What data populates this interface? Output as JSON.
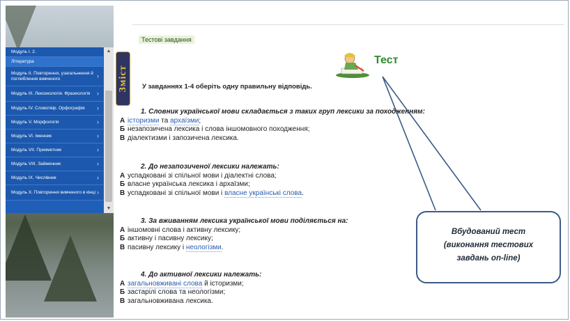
{
  "sidebar": {
    "items": [
      {
        "label": "Модуль І. 2.",
        "sub": false,
        "arrow": ""
      },
      {
        "label": "Література",
        "sub": true,
        "arrow": ""
      },
      {
        "label": "Модуль ІІ. Повторення, узагальнення й поглиблення вивченого",
        "sub": false,
        "arrow": "›"
      },
      {
        "label": "Модуль ІІІ. Лексикологія. Фразеологія",
        "sub": false,
        "arrow": "›"
      },
      {
        "label": "Модуль IV. Словотвір. Орфографія",
        "sub": false,
        "arrow": "›"
      },
      {
        "label": "Модуль V. Морфологія",
        "sub": false,
        "arrow": "›"
      },
      {
        "label": "Модуль VI. Іменник",
        "sub": false,
        "arrow": "›"
      },
      {
        "label": "Модуль VII. Прикметник",
        "sub": false,
        "arrow": "›"
      },
      {
        "label": "Модуль VIII. Займенник",
        "sub": false,
        "arrow": "›"
      },
      {
        "label": "Модуль IX. Числівник",
        "sub": false,
        "arrow": "›"
      },
      {
        "label": "Модуль X. Повторення вивченого в кінці",
        "sub": false,
        "arrow": "›"
      }
    ],
    "scroll_up": "▲",
    "scroll_down": "▼"
  },
  "contents_tab": "Зміст",
  "page": {
    "tab_label": "Тестові завдання",
    "test_title": "Тест",
    "instruction": "У завданнях 1-4 оберіть одну правильну відповідь."
  },
  "questions": [
    {
      "title": "1. Словник української мови складається з таких груп лексики за походженням:",
      "answers": [
        {
          "letter": "А",
          "parts": [
            {
              "t": "історизми",
              "link": true
            },
            {
              "t": " та ",
              "link": false
            },
            {
              "t": "архаїзми",
              "link": true
            },
            {
              "t": ";",
              "link": false
            }
          ]
        },
        {
          "letter": "Б",
          "parts": [
            {
              "t": "незапозичена лексика і слова іншомовного походження;",
              "link": false
            }
          ]
        },
        {
          "letter": "В",
          "parts": [
            {
              "t": "діалектизми і запозичена лексика.",
              "link": false
            }
          ]
        }
      ]
    },
    {
      "title": "2. До незапозиченої лексики належать:",
      "answers": [
        {
          "letter": "А",
          "parts": [
            {
              "t": "успадковані зі спільної мови і діалектні слова;",
              "link": false
            }
          ]
        },
        {
          "letter": "Б",
          "parts": [
            {
              "t": "власне українська лексика і архаїзми;",
              "link": false
            }
          ]
        },
        {
          "letter": "В",
          "parts": [
            {
              "t": "успадковані зі спільної мови і ",
              "link": false
            },
            {
              "t": "власне українські слова",
              "link": true
            },
            {
              "t": ".",
              "link": false
            }
          ]
        }
      ]
    },
    {
      "title": "3. За вживанням лексика української мови поділяється на:",
      "answers": [
        {
          "letter": "А",
          "parts": [
            {
              "t": "іншомовні слова і активну лексику;",
              "link": false
            }
          ]
        },
        {
          "letter": "Б",
          "parts": [
            {
              "t": "активну і пасивну лексику;",
              "link": false
            }
          ]
        },
        {
          "letter": "В",
          "parts": [
            {
              "t": "пасивну лексику і ",
              "link": false
            },
            {
              "t": "неологізми",
              "link": true
            },
            {
              "t": ".",
              "link": false
            }
          ]
        }
      ]
    },
    {
      "title": "4. До активної лексики належать:",
      "answers": [
        {
          "letter": "А",
          "parts": [
            {
              "t": "загальновживані слова",
              "link": true
            },
            {
              "t": " й історизми;",
              "link": false
            }
          ]
        },
        {
          "letter": "Б",
          "parts": [
            {
              "t": "застарілі слова та неологізми;",
              "link": false
            }
          ]
        },
        {
          "letter": "В",
          "parts": [
            {
              "t": "загальновживана лексика.",
              "link": false
            }
          ]
        }
      ]
    }
  ],
  "callout": {
    "lines": [
      "Вбудований тест",
      "(виконання тестових",
      "завдань on-line)"
    ],
    "border_color": "#3b5a86"
  }
}
